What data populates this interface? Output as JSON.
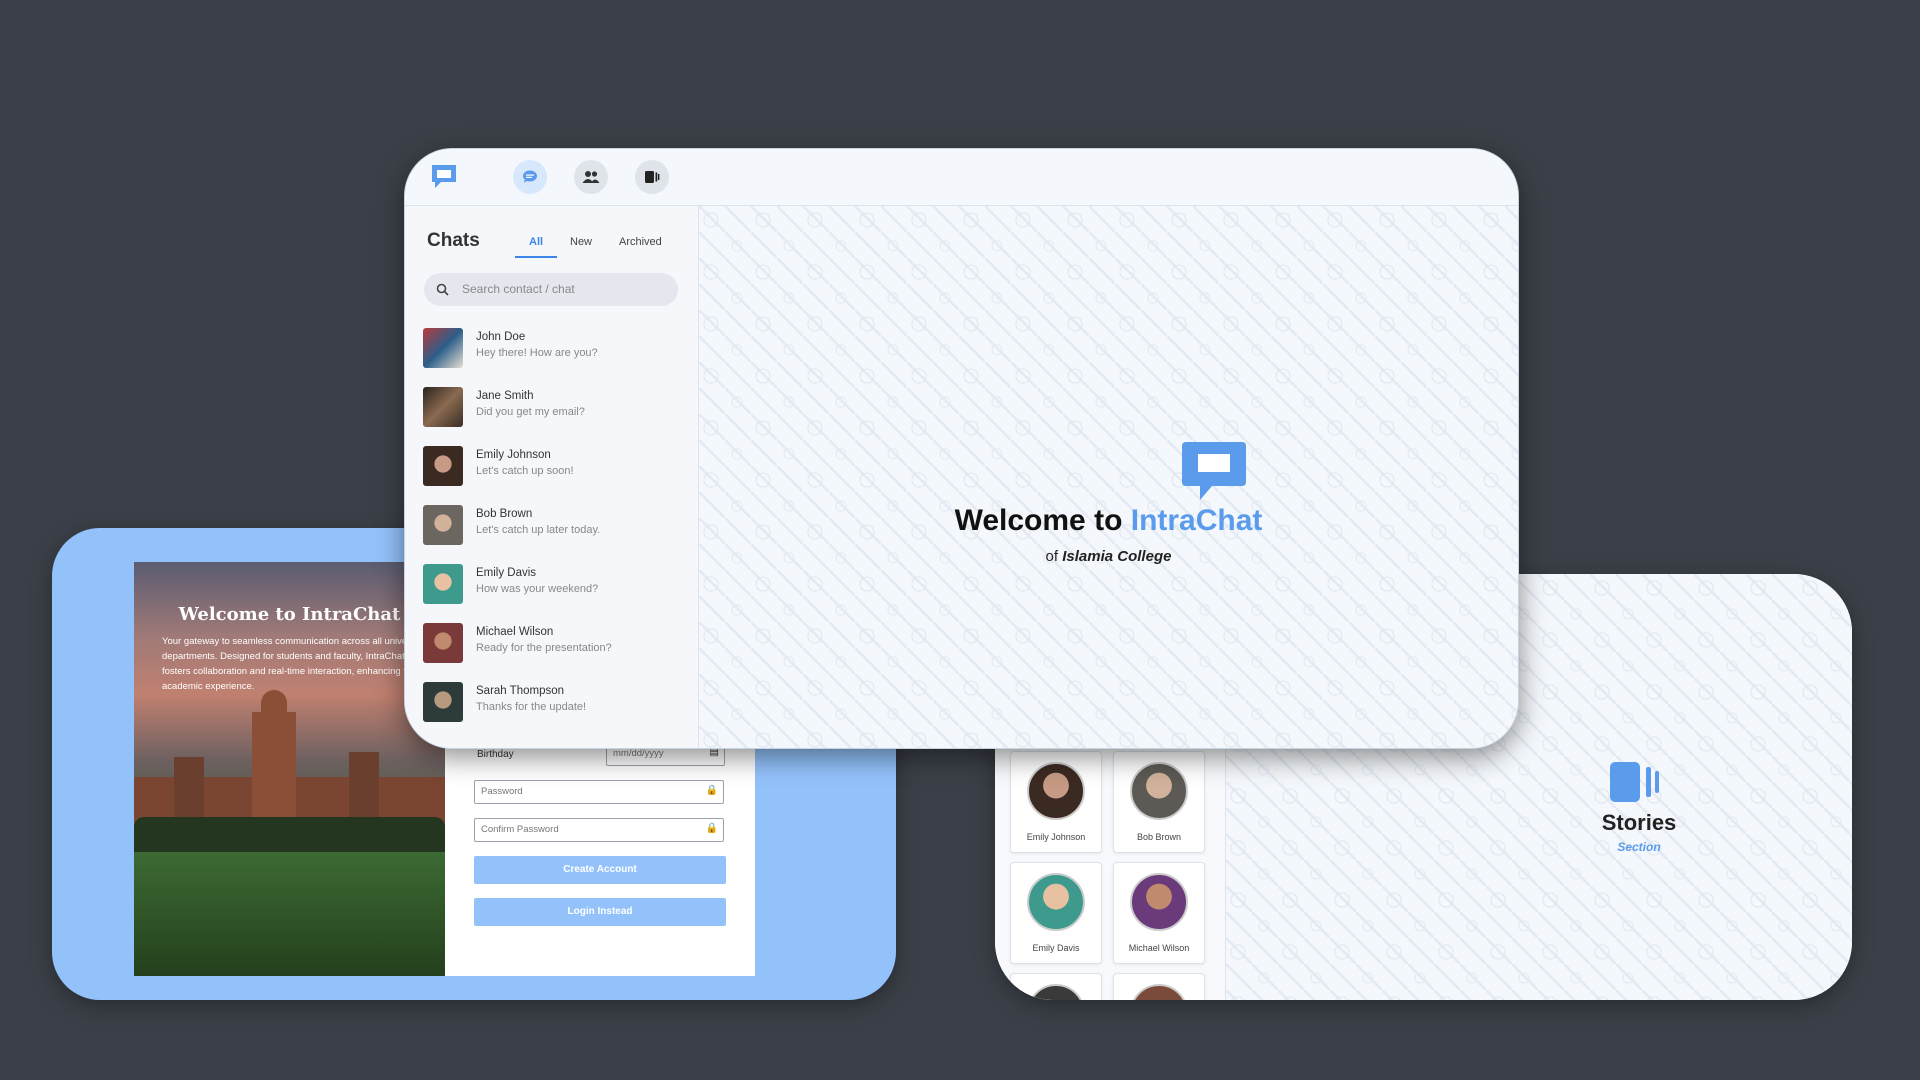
{
  "colors": {
    "background": "#3b4048",
    "accent": "#5b9bec",
    "signup_bg": "#93c2fb"
  },
  "signup": {
    "hero_title": "Welcome to IntraChat",
    "hero_text": "Your gateway to seamless communication across all university departments. Designed for students and faculty, IntraChat fosters collaboration and real-time interaction, enhancing your academic experience.",
    "birthday_label": "Birthday",
    "birthday_placeholder": "mm/dd/yyyy",
    "password_placeholder": "Password",
    "confirm_placeholder": "Confirm Password",
    "create_button": "Create Account",
    "login_button": "Login Instead"
  },
  "stories": {
    "tiles": [
      {
        "name": "Emily Johnson"
      },
      {
        "name": "Bob Brown"
      },
      {
        "name": "Emily Davis"
      },
      {
        "name": "Michael Wilson"
      }
    ],
    "title": "Stories",
    "subtitle": "Section"
  },
  "chat": {
    "nav_icons": [
      "chat-bubble-icon",
      "users-icon",
      "stories-icon"
    ],
    "title": "Chats",
    "tabs": [
      "All",
      "New",
      "Archived"
    ],
    "active_tab": "All",
    "search_placeholder": "Search contact / chat",
    "items": [
      {
        "name": "John Doe",
        "message": "Hey there! How are you?"
      },
      {
        "name": "Jane Smith",
        "message": "Did you get my email?"
      },
      {
        "name": "Emily Johnson",
        "message": "Let's catch up soon!"
      },
      {
        "name": "Bob Brown",
        "message": "Let's catch up later today."
      },
      {
        "name": "Emily Davis",
        "message": "How was your weekend?"
      },
      {
        "name": "Michael Wilson",
        "message": "Ready for the presentation?"
      },
      {
        "name": "Sarah Thompson",
        "message": "Thanks for the update!"
      }
    ],
    "welcome_prefix": "Welcome to ",
    "welcome_brand": "IntraChat",
    "welcome_of": "of ",
    "welcome_college": "Islamia College"
  }
}
